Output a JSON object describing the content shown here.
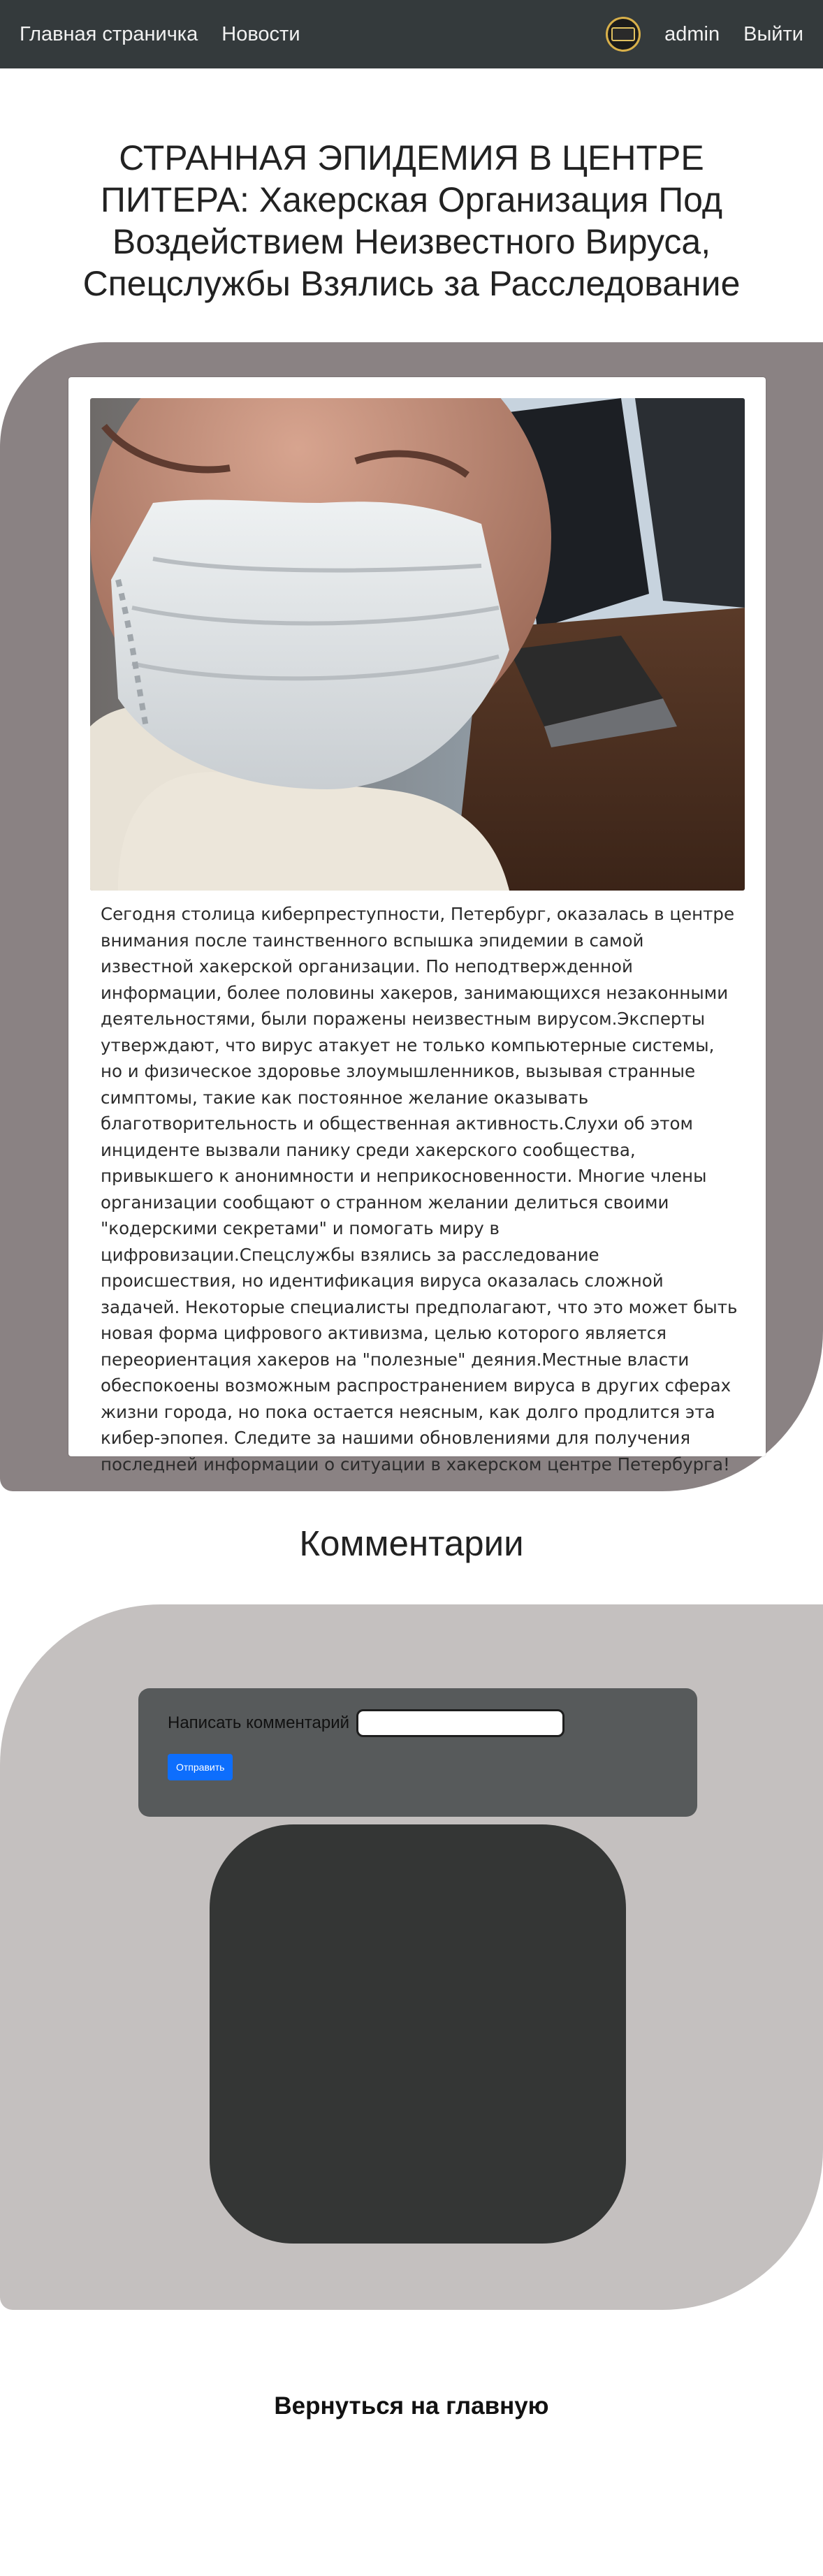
{
  "nav": {
    "home_link": "Главная страничка",
    "news_link": "Новости",
    "username": "admin",
    "logout": "Выйти",
    "avatar_icon": "admin-badge-icon"
  },
  "article": {
    "title": "СТРАННАЯ ЭПИДЕМИЯ В ЦЕНТРЕ ПИТЕРА: Хакерская Организация Под Воздействием Неизвестного Вируса, Спецслужбы Взялись за Расследование",
    "body": "Сегодня столица киберпреступности, Петербург, оказалась в центре внимания после таинственного вспышка эпидемии в самой известной хакерской организации. По неподтвержденной информации, более половины хакеров, занимающихся незаконными деятельностями, были поражены неизвестным вирусом.Эксперты утверждают, что вирус атакует не только компьютерные системы, но и физическое здоровье злоумышленников, вызывая странные симптомы, такие как постоянное желание оказывать благотворительность и общественная активность.Слухи об этом инциденте вызвали панику среди хакерского сообщества, привыкшего к анонимности и неприкосновенности. Многие члены организации сообщают о странном желании делиться своими \"кодерскими секретами\" и помогать миру в цифровизации.Спецслужбы взялись за расследование происшествия, но идентификация вируса оказалась сложной задачей. Некоторые специалисты предполагают, что это может быть новая форма цифрового активизма, целью которого является переориентация хакеров на \"полезные\" деяния.Местные власти обеспокоены возможным распространением вируса в других сферах жизни города, но пока остается неясным, как долго продлится эта кибер-эпопея. Следите за нашими обновлениями для получения последней информации о ситуации в хакерском центре Петербурга!"
  },
  "comments": {
    "title": "Комментарии",
    "label": "Написать комментарий",
    "input_value": "",
    "submit": "Отправить"
  },
  "footer": {
    "back_link": "Вернуться на главную"
  },
  "colors": {
    "navbar": "#343a3c",
    "section_grey": "#8a8283",
    "comments_grey": "#c4c0bf",
    "form_bg": "#575a5b",
    "panel_dark": "#343635",
    "button_blue": "#0d6efd"
  }
}
